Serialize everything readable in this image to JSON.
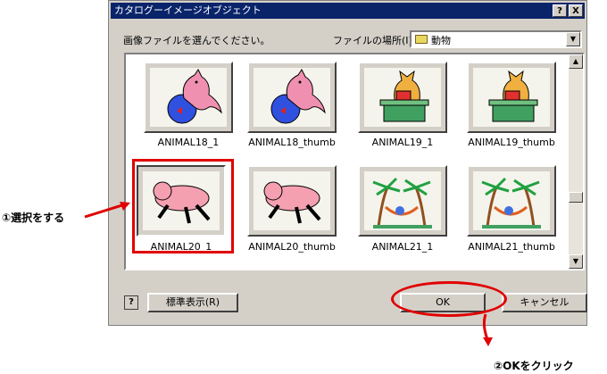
{
  "dialog": {
    "title": "カタログーイメージオブジェクト",
    "help_btn": "?",
    "close_btn": "X",
    "prompt": "画像ファイルを選んでください。",
    "location_label": "ファイルの場所(I):",
    "location_value": "動物"
  },
  "thumbnails": [
    {
      "caption": "ANIMAL18_1",
      "icon": "cat-fishbowl"
    },
    {
      "caption": "ANIMAL18_thumb",
      "icon": "cat-fishbowl"
    },
    {
      "caption": "ANIMAL19_1",
      "icon": "cat-desk"
    },
    {
      "caption": "ANIMAL19_thumb",
      "icon": "cat-desk"
    },
    {
      "caption": "ANIMAL20_1",
      "icon": "pink-pig"
    },
    {
      "caption": "ANIMAL20_thumb",
      "icon": "pink-pig"
    },
    {
      "caption": "ANIMAL21_1",
      "icon": "palm-hammock"
    },
    {
      "caption": "ANIMAL21_thumb",
      "icon": "palm-hammock"
    }
  ],
  "footer": {
    "help_icon": "?",
    "standard_view": "標準表示(R)",
    "ok": "OK",
    "cancel": "キャンセル"
  },
  "annotations": {
    "step1": "①選択をする",
    "step2": "②OKをクリック"
  },
  "colors": {
    "highlight": "#e00000",
    "titlebar": "#0a246a"
  }
}
